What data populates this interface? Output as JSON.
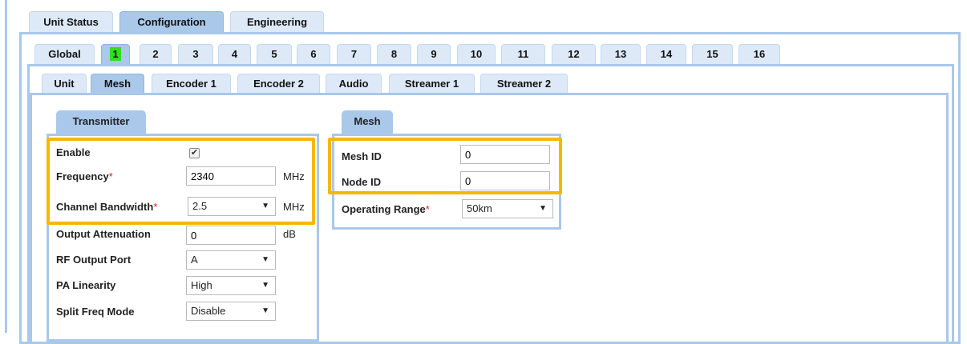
{
  "top_tabs": [
    "Unit Status",
    "Configuration",
    "Engineering"
  ],
  "channel_tabs": [
    "Global",
    "1",
    "2",
    "3",
    "4",
    "5",
    "6",
    "7",
    "8",
    "9",
    "10",
    "11",
    "12",
    "13",
    "14",
    "15",
    "16"
  ],
  "sub_tabs": [
    "Unit",
    "Mesh",
    "Encoder 1",
    "Encoder 2",
    "Audio",
    "Streamer 1",
    "Streamer 2"
  ],
  "transmitter": {
    "header": "Transmitter",
    "enable_label": "Enable",
    "enable_checked": true,
    "frequency_label": "Frequency",
    "frequency_value": "2340",
    "frequency_unit": "MHz",
    "bandwidth_label": "Channel Bandwidth",
    "bandwidth_value": "2.5",
    "bandwidth_unit": "MHz",
    "attenuation_label": "Output Attenuation",
    "attenuation_value": "0",
    "attenuation_unit": "dB",
    "rf_port_label": "RF Output Port",
    "rf_port_value": "A",
    "pa_label": "PA Linearity",
    "pa_value": "High",
    "split_label": "Split Freq Mode",
    "split_value": "Disable",
    "required_mark": "*"
  },
  "mesh": {
    "header": "Mesh",
    "mesh_id_label": "Mesh ID",
    "mesh_id_value": "0",
    "node_id_label": "Node ID",
    "node_id_value": "0",
    "range_label": "Operating Range",
    "range_value": "50km",
    "required_mark": "*"
  },
  "icons": {
    "dropdown": "chevron-down-icon",
    "check": "check-icon"
  },
  "colors": {
    "tab_bg": "#dde9f7",
    "tab_active": "#a9c8ea",
    "selected_channel": "#33dd22",
    "highlight": "#f5b800",
    "required": "#e02020"
  }
}
